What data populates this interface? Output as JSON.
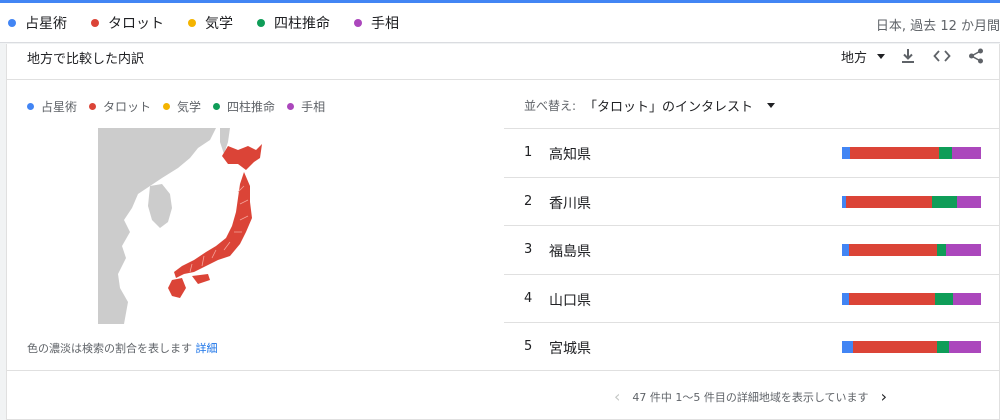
{
  "legend": {
    "items": [
      {
        "label": "占星術",
        "color": "#4285f4"
      },
      {
        "label": "タロット",
        "color": "#db4437"
      },
      {
        "label": "気学",
        "color": "#f4b400"
      },
      {
        "label": "四柱推命",
        "color": "#0f9d58"
      },
      {
        "label": "手相",
        "color": "#ab47bc"
      }
    ],
    "meta": "日本, 過去 12 か月間"
  },
  "card": {
    "title": "地方で比較した内訳",
    "region_label": "地方",
    "icons": [
      "download-icon",
      "embed-code-icon",
      "share-icon"
    ]
  },
  "map": {
    "caption_text": "色の濃淡は検索の割合を表します",
    "caption_link": "詳細"
  },
  "sort": {
    "label": "並べ替え:",
    "value": "「タロット」のインタレスト"
  },
  "rows": [
    {
      "rank": "1",
      "name": "高知県",
      "shares": [
        0.06,
        0.64,
        0.0,
        0.09,
        0.21
      ]
    },
    {
      "rank": "2",
      "name": "香川県",
      "shares": [
        0.03,
        0.62,
        0.0,
        0.18,
        0.17
      ]
    },
    {
      "rank": "3",
      "name": "福島県",
      "shares": [
        0.05,
        0.63,
        0.0,
        0.07,
        0.25
      ]
    },
    {
      "rank": "4",
      "name": "山口県",
      "shares": [
        0.05,
        0.62,
        0.0,
        0.13,
        0.2
      ]
    },
    {
      "rank": "5",
      "name": "宮城県",
      "shares": [
        0.08,
        0.6,
        0.0,
        0.09,
        0.23
      ]
    }
  ],
  "pager": {
    "text": "47 件中 1～5 件目の詳細地域を表示しています"
  }
}
